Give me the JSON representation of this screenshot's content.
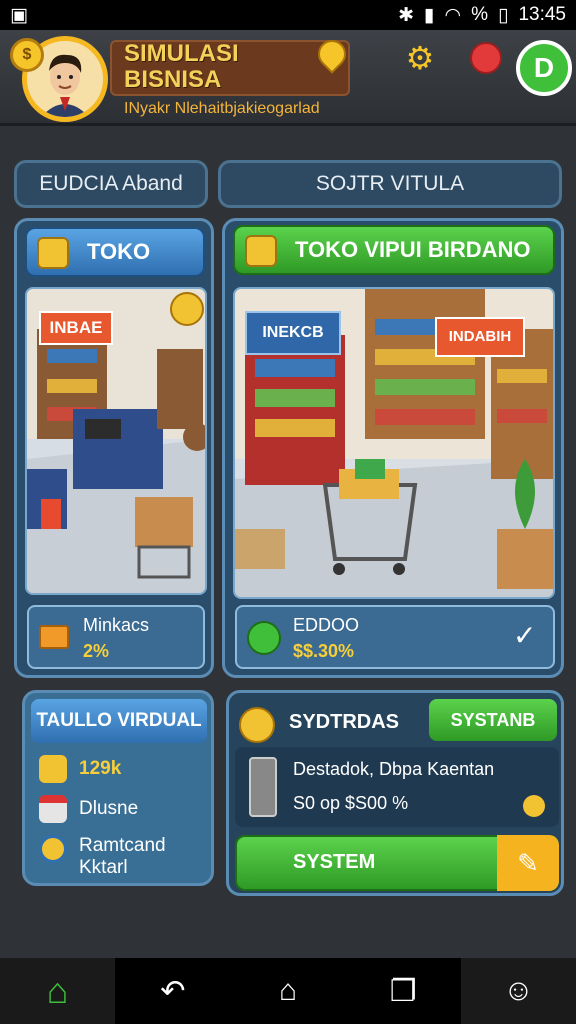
{
  "status": {
    "time": "13:45",
    "battery": "%"
  },
  "header": {
    "title_line1": "SIMULASI",
    "title_line2": "BISNISA",
    "subtitle": "INyakr Nlehaitbjakieogarlad",
    "coin_symbol": "$"
  },
  "tabs": [
    {
      "label": "EUDCIA Aband"
    },
    {
      "label": "SOJTR VITULA"
    }
  ],
  "left_panel": {
    "header": "TOKO",
    "scene_sign": "INBAE",
    "info_title": "Minkacs",
    "info_value": "2%"
  },
  "right_panel": {
    "header": "TOKO VIPUI BIRDANO",
    "scene_sign1": "INEKCB",
    "scene_sign2": "INDABIH",
    "info_title": "EDDOO",
    "info_value": "$$.30%"
  },
  "stats_panel": {
    "header": "TAULLO VIRDUAL",
    "rows": [
      {
        "label": "129k"
      },
      {
        "label": "Dlusne"
      },
      {
        "label": "Ramtcand"
      },
      {
        "label": "Kktarl"
      }
    ]
  },
  "system_panel": {
    "header": "SYDTRDAS",
    "action": "SYSTANB",
    "desc_title": "Destadok, Dbpa Kaentan",
    "desc_value": "S0 op $S00 %",
    "system_button": "SYSTEM"
  },
  "colors": {
    "accent_green": "#3fbf3a",
    "accent_gold": "#f5c52a",
    "panel_blue": "#2a4d6b"
  }
}
